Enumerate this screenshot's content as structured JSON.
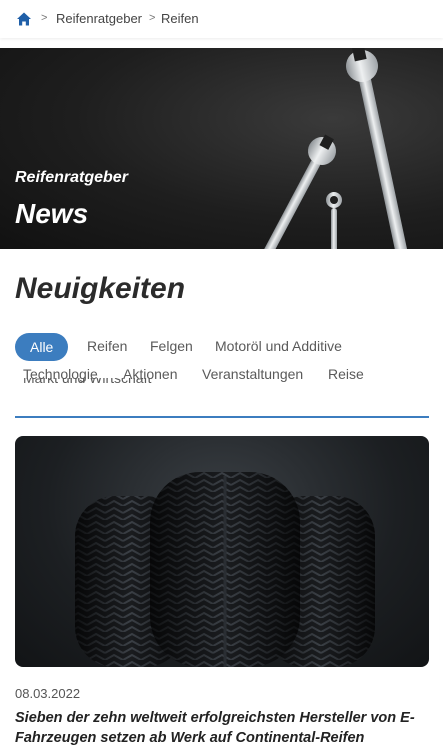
{
  "breadcrumb": {
    "items": [
      "Reifenratgeber",
      "Reifen"
    ],
    "separator": ">",
    "home_icon": "home-icon"
  },
  "hero": {
    "subtitle": "Reifenratgeber",
    "title": "News"
  },
  "section": {
    "heading": "Neuigkeiten"
  },
  "filters": {
    "active": "Alle",
    "items": [
      "Alle",
      "Reifen",
      "Felgen",
      "Motoröl und Additive",
      "Technologie",
      "Aktionen",
      "Veranstaltungen",
      "Reise",
      "Markt und Wirtschaft"
    ]
  },
  "article": {
    "date": "08.03.2022",
    "title": "Sieben der zehn weltweit erfolgreichsten Hersteller von E-Fahrzeugen setzen ab Werk auf Continental-Reifen"
  },
  "colors": {
    "accent": "#3c7dbf",
    "text": "#222222"
  }
}
